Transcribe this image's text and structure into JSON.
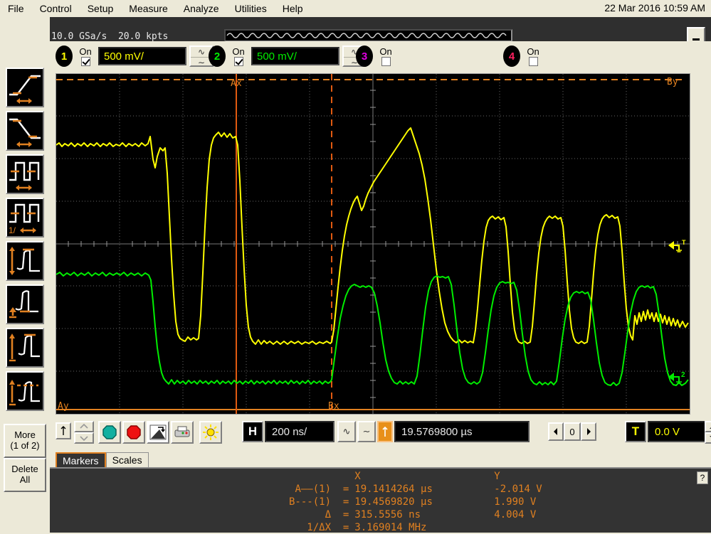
{
  "menu": {
    "items": [
      "File",
      "Control",
      "Setup",
      "Measure",
      "Analyze",
      "Utilities",
      "Help"
    ],
    "clock": "22 Mar 2016 10:59 AM"
  },
  "acquisition": {
    "sample_rate": "10.0 GSa/s",
    "memory_depth": "20.0 kpts",
    "minimize_label": "minimize-icon"
  },
  "channels": [
    {
      "num": "1",
      "on_label": "On",
      "enabled": true,
      "scale": "500 mV/",
      "color": "#ffff00"
    },
    {
      "num": "2",
      "on_label": "On",
      "enabled": true,
      "scale": "500 mV/",
      "color": "#00ee00"
    },
    {
      "num": "3",
      "on_label": "On",
      "enabled": false,
      "scale": "",
      "color": "#e000e0"
    },
    {
      "num": "4",
      "on_label": "On",
      "enabled": false,
      "scale": "",
      "color": "#ff2060"
    }
  ],
  "timebase": {
    "h_label": "H",
    "scale": "200 ns/",
    "delay": "19.5769800 µs",
    "nav_value": "0"
  },
  "trigger": {
    "t_label": "T",
    "level": "0.0 V"
  },
  "graticule": {
    "marker_labels": {
      "ax": "Ax",
      "ay": "Ay",
      "bx": "Bx",
      "by": "By"
    },
    "ground_markers": [
      {
        "label": "1",
        "trig": "T",
        "color": "#ffff00"
      },
      {
        "label": "2",
        "trig": "",
        "color": "#00ee00"
      }
    ]
  },
  "left_toolbar": {
    "icons": [
      "rise-time-icon",
      "fall-time-icon",
      "pulse-width-icon",
      "frequency-icon",
      "amplitude-icon",
      "base-level-icon",
      "top-level-icon",
      "peak-to-peak-icon"
    ],
    "more_label": "More",
    "more_sub": "(1 of 2)",
    "delete_label": "Delete",
    "delete_sub": "All"
  },
  "toolbar_icons": [
    "move-up-icon",
    "spinner-icon",
    "run-icon",
    "stop-icon",
    "single-icon",
    "print-icon",
    "autoscale-icon"
  ],
  "tabs": [
    {
      "label": "Markers",
      "active": true
    },
    {
      "label": "Scales",
      "active": false
    }
  ],
  "results": {
    "header_x": "X",
    "header_y": "Y",
    "rows": [
      {
        "label": "A——(1)  =",
        "x": "19.1414264 µs",
        "y": "-2.014 V"
      },
      {
        "label": "B---(1)  =",
        "x": "19.4569820 µs",
        "y": "1.990 V"
      },
      {
        "label": "Δ  =",
        "x": "315.5556 ns",
        "y": "4.004 V"
      },
      {
        "label": "1/ΔX  =",
        "x": "3.169014 MHz",
        "y": ""
      }
    ],
    "help_label": "?"
  },
  "colors": {
    "marker": "#e08020",
    "ch1": "#ffff00",
    "ch2": "#00ee00",
    "panel": "#ece9d8",
    "screen_bg": "#000000"
  }
}
